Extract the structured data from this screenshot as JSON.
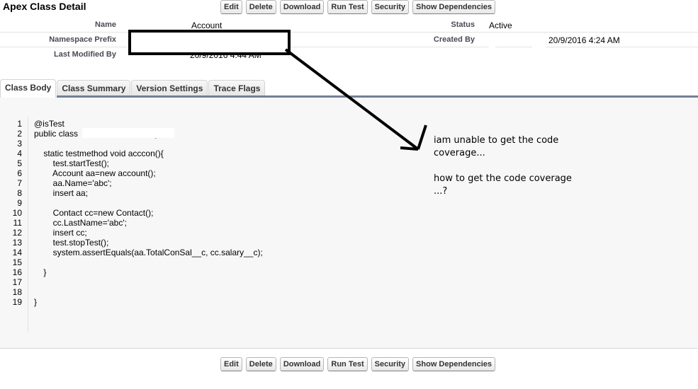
{
  "header": {
    "title": "Apex Class Detail"
  },
  "toolbar": {
    "buttons": [
      "Edit",
      "Delete",
      "Download",
      "Run Test",
      "Security",
      "Show Dependencies"
    ]
  },
  "details": {
    "name_label": "Name",
    "name_value": "Account",
    "namespace_label": "Namespace Prefix",
    "namespace_value": "",
    "last_modified_label": "Last Modified By",
    "last_modified_value": "20/9/2016 4:44 AM",
    "status_label": "Status",
    "status_value": "Active",
    "created_by_label": "Created By",
    "created_by_value": "20/9/2016 4:24 AM"
  },
  "tabs": [
    {
      "label": "Class Body",
      "active": true
    },
    {
      "label": "Class Summary",
      "active": false
    },
    {
      "label": "Version Settings",
      "active": false
    },
    {
      "label": "Trace Flags",
      "active": false
    }
  ],
  "code": {
    "lines": [
      {
        "n": "1",
        "text": "@isTest"
      },
      {
        "n": "2",
        "text": "public class                                {"
      },
      {
        "n": "3",
        "text": ""
      },
      {
        "n": "4",
        "text": "    static testmethod void acccon(){"
      },
      {
        "n": "5",
        "text": "        test.startTest();"
      },
      {
        "n": "6",
        "text": "        Account aa=new account();"
      },
      {
        "n": "7",
        "text": "        aa.Name='abc';"
      },
      {
        "n": "8",
        "text": "        insert aa;"
      },
      {
        "n": "9",
        "text": ""
      },
      {
        "n": "10",
        "text": "        Contact cc=new Contact();"
      },
      {
        "n": "11",
        "text": "        cc.LastName='abc';"
      },
      {
        "n": "12",
        "text": "        insert cc;"
      },
      {
        "n": "13",
        "text": "        test.stopTest();"
      },
      {
        "n": "14",
        "text": "        system.assertEquals(aa.TotalConSal__c, cc.salary__c);"
      },
      {
        "n": "15",
        "text": ""
      },
      {
        "n": "16",
        "text": "    }"
      },
      {
        "n": "17",
        "text": ""
      },
      {
        "n": "18",
        "text": ""
      },
      {
        "n": "19",
        "text": "}"
      }
    ]
  },
  "annotation": {
    "line1": "iam unable to get the code coverage...",
    "line2": "how to get the code coverage ...?"
  }
}
